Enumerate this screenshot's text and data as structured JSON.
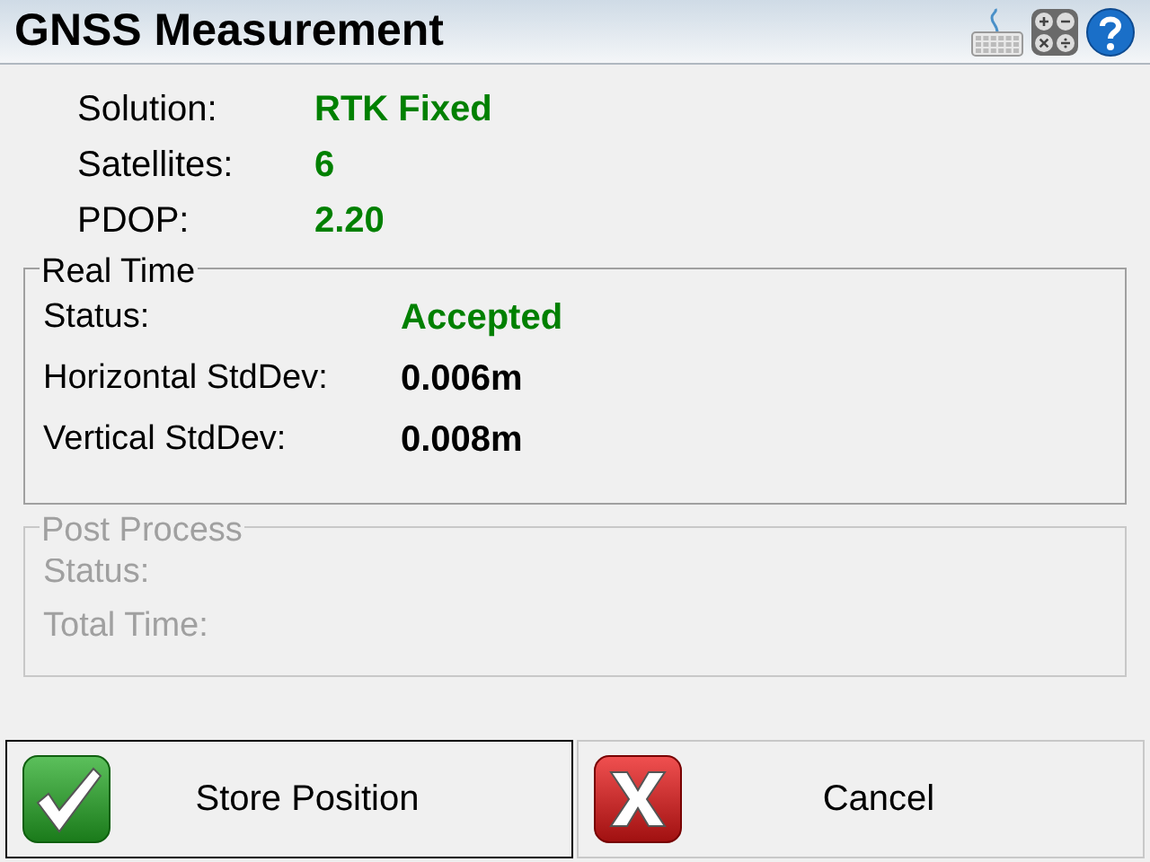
{
  "window": {
    "title": "GNSS Measurement"
  },
  "summary": [
    {
      "label": "Solution:",
      "value": "RTK Fixed",
      "kind": "status"
    },
    {
      "label": "Satellites:",
      "value": "6",
      "kind": "status"
    },
    {
      "label": "PDOP:",
      "value": "2.20",
      "kind": "status"
    }
  ],
  "groups": [
    {
      "title": "Real Time",
      "disabled": false,
      "rows": [
        {
          "label": "Status:",
          "value": "Accepted",
          "kind": "status"
        },
        {
          "label": "Horizontal StdDev:",
          "value": "0.006m",
          "kind": "measure"
        },
        {
          "label": "Vertical StdDev:",
          "value": "0.008m",
          "kind": "measure"
        }
      ]
    },
    {
      "title": "Post Process",
      "disabled": true,
      "rows": [
        {
          "label": "Status:"
        },
        {
          "label": "Total Time:"
        }
      ]
    }
  ],
  "buttons": [
    {
      "label": "Store Position",
      "kind": "confirm",
      "focused": true
    },
    {
      "label": "Cancel",
      "kind": "cancel",
      "focused": false
    }
  ]
}
